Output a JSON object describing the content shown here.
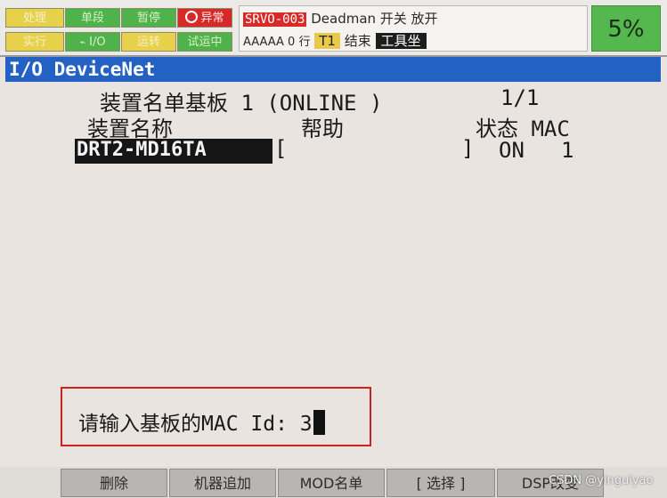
{
  "status": {
    "lamps": {
      "processing": "处理",
      "step": "单段",
      "hold": "暂停",
      "fault": "异常",
      "running": "实行",
      "io": "I/O",
      "operation": "运转",
      "testing": "试运中"
    },
    "messages": {
      "alarm_code": "SRVO-003",
      "alarm_text": "Deadman  开关 放开",
      "program": "AAAAA 0 行",
      "mode": "T1",
      "state": "结束",
      "frame": "工具坐"
    },
    "override": "5%"
  },
  "screen": {
    "title": "I/O DeviceNet",
    "board_label": "装置名单基板 1  (ONLINE )",
    "page": "1/1",
    "columns": {
      "name": "装置名称",
      "help": "帮助",
      "status_mac": "状态 MAC"
    },
    "rows": [
      {
        "name": "DRT2-MD16TA",
        "help_open": "[",
        "help_close": "]",
        "status": "ON",
        "mac": "1"
      }
    ],
    "prompt": {
      "label": "请输入基板的MAC Id: ",
      "value": "3"
    }
  },
  "function_keys": [
    "删除",
    "机器追加",
    "MOD名单",
    "[ 选择 ]",
    "DSP改变"
  ],
  "watermark": "CSDN @yinguiyao"
}
